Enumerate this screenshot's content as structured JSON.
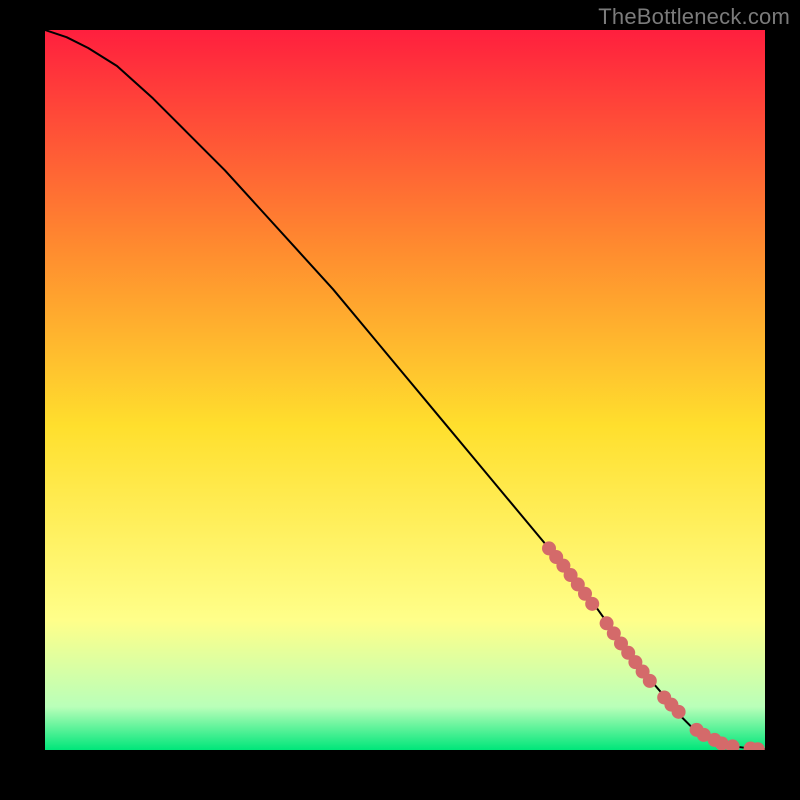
{
  "watermark": "TheBottleneck.com",
  "chart_data": {
    "type": "line",
    "title": "",
    "xlabel": "",
    "ylabel": "",
    "xlim": [
      0,
      100
    ],
    "ylim": [
      0,
      100
    ],
    "grid": false,
    "legend": false,
    "curve": {
      "description": "Black decreasing curve from top-left to bottom-right, levelling off near x≈90",
      "x": [
        0,
        3,
        6,
        10,
        15,
        20,
        25,
        30,
        35,
        40,
        45,
        50,
        55,
        60,
        65,
        70,
        75,
        80,
        83,
        86,
        88,
        90,
        92,
        95,
        98,
        100
      ],
      "y": [
        100,
        99,
        97.5,
        95,
        90.5,
        85.5,
        80.5,
        75,
        69.5,
        64,
        58,
        52,
        46,
        40,
        34,
        28,
        22,
        15,
        11,
        7.5,
        5,
        3,
        1.5,
        0.6,
        0.2,
        0.1
      ]
    },
    "marker_series": {
      "name": "highlighted points",
      "color": "#d46a6a",
      "x": [
        70,
        71,
        72,
        73,
        74,
        75,
        76,
        78,
        79,
        80,
        81,
        82,
        83,
        84,
        86,
        87,
        88,
        90.5,
        91.5,
        93,
        94,
        95.5,
        98,
        99
      ],
      "y": [
        28,
        26.8,
        25.6,
        24.3,
        23,
        21.7,
        20.3,
        17.6,
        16.2,
        14.8,
        13.5,
        12.2,
        10.9,
        9.6,
        7.3,
        6.3,
        5.3,
        2.8,
        2.1,
        1.4,
        0.9,
        0.5,
        0.2,
        0.1
      ]
    },
    "background_gradient": {
      "top": "#ff1f3e",
      "upper_mid": "#ff8a2f",
      "mid": "#ffdf2d",
      "lower_mid": "#ffff8a",
      "near_bottom": "#b9ffb9",
      "bottom": "#00e67a"
    }
  }
}
